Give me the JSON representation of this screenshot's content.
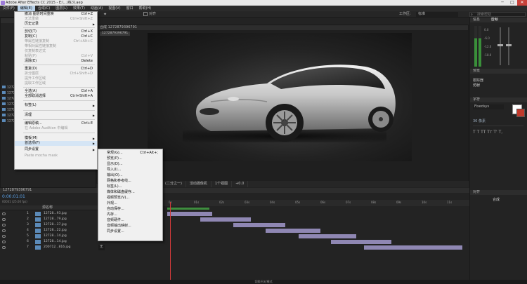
{
  "window": {
    "title": "Adobe After Effects CC 2015 - E:\\...\\练习.aep",
    "min": "─",
    "max": "□",
    "close": "✕"
  },
  "menubar": [
    "文件(F)",
    "编辑(E)",
    "合成(C)",
    "图层(L)",
    "效果(T)",
    "动画(A)",
    "视图(V)",
    "窗口",
    "帮助(H)"
  ],
  "toolbar": {
    "snap_label": "对齐",
    "workspace_label": "工作区:",
    "workspace_value": "标准",
    "search_placeholder": "搜索帮助"
  },
  "edit_menu": [
    {
      "label": "撤消 图层时间重映",
      "shortcut": "Ctrl+Z"
    },
    {
      "label": "无法重做",
      "shortcut": "Ctrl+Shift+Z",
      "disabled": true
    },
    {
      "label": "历史记录",
      "submenu": true
    },
    {
      "sep": true
    },
    {
      "label": "剪切(T)",
      "shortcut": "Ctrl+X"
    },
    {
      "label": "复制(C)",
      "shortcut": "Ctrl+C"
    },
    {
      "label": "带属性链接复制",
      "shortcut": "Ctrl+Alt+C",
      "disabled": true
    },
    {
      "label": "带相对属性链接复制",
      "disabled": true
    },
    {
      "label": "仅复制表达式",
      "disabled": true
    },
    {
      "label": "粘贴(P)",
      "shortcut": "Ctrl+V",
      "disabled": true
    },
    {
      "label": "清除(E)",
      "shortcut": "Delete"
    },
    {
      "sep": true
    },
    {
      "label": "重复(D)",
      "shortcut": "Ctrl+D"
    },
    {
      "label": "拆分图层",
      "shortcut": "Ctrl+Shift+D",
      "disabled": true
    },
    {
      "label": "提升工作区域",
      "disabled": true
    },
    {
      "label": "提取工作区域",
      "disabled": true
    },
    {
      "sep": true
    },
    {
      "label": "全选(A)",
      "shortcut": "Ctrl+A"
    },
    {
      "label": "全部取消选择",
      "shortcut": "Ctrl+Shift+A"
    },
    {
      "sep": true
    },
    {
      "label": "标签(L)",
      "submenu": true
    },
    {
      "sep": true
    },
    {
      "label": "清理",
      "submenu": true
    },
    {
      "sep": true
    },
    {
      "label": "编辑原稿...",
      "shortcut": "Ctrl+E"
    },
    {
      "label": "在 Adobe Audition 中编辑",
      "disabled": true
    },
    {
      "sep": true
    },
    {
      "label": "模板(M)",
      "submenu": true
    },
    {
      "label": "首选项(F)",
      "submenu": true,
      "highlight": true
    },
    {
      "label": "同步设置",
      "submenu": true
    },
    {
      "label": "Paste mocha mask",
      "disabled": true
    }
  ],
  "prefs_submenu": [
    {
      "label": "常规(G)...",
      "shortcut": "Ctrl+Alt+;"
    },
    {
      "label": "预览(P)..."
    },
    {
      "label": "显示(D)..."
    },
    {
      "label": "导入(I)..."
    },
    {
      "label": "输出(O)..."
    },
    {
      "label": "网格和参考线..."
    },
    {
      "label": "标签(L)..."
    },
    {
      "label": "媒体和磁盘缓存..."
    },
    {
      "label": "视频预览(V)..."
    },
    {
      "label": "外观..."
    },
    {
      "label": "自动保存..."
    },
    {
      "label": "内存..."
    },
    {
      "label": "音频硬件..."
    },
    {
      "label": "音频输出映射..."
    },
    {
      "label": "同步设置..."
    }
  ],
  "comp_panel": {
    "tab": "合成 1272879396791",
    "breadcrumb": "1272879396791"
  },
  "viewer_bar": [
    "(二分之一)",
    "活动摄像机",
    "1个视图",
    "+0.0"
  ],
  "project_panel": {
    "items": [
      "12728...jpg",
      "12728...jpg",
      "12728...jpg",
      "12728...jpg",
      "12728...jpg",
      "12728...jpg",
      "12728...jpg"
    ]
  },
  "timeline": {
    "tab": "1272879396791",
    "timecode": "0:00:01:01",
    "fps": "00031 (25.00 fps)",
    "col_header": "源名称",
    "layers": [
      {
        "num": "1",
        "name": "12728...93.jpg"
      },
      {
        "num": "2",
        "name": "12728...79.jpg"
      },
      {
        "num": "3",
        "name": "12728...37.jpg"
      },
      {
        "num": "4",
        "name": "12728...22.jpg"
      },
      {
        "num": "5",
        "name": "12728...14.jpg"
      },
      {
        "num": "6",
        "name": "12728...14.jpg"
      },
      {
        "num": "7",
        "name": "200712...816.jpg"
      }
    ],
    "mode_none": "无",
    "ruler_ticks": [
      "0s",
      "01s",
      "02s",
      "03s",
      "04s",
      "05s",
      "06s",
      "07s",
      "08s",
      "09s",
      "10s",
      "11s"
    ]
  },
  "right_panels": {
    "info_tab": "信息",
    "audio_tab": "音频",
    "db_labels": [
      "0.0",
      "-6.0",
      "-12.0",
      "-18.0",
      "-24.0"
    ],
    "preview_tab": "预览",
    "tracker_tab": "跟踪器",
    "tracker_value": "仿射",
    "char_tab": "字符",
    "font": "Fixedsys",
    "size_label": "36 像素",
    "align_tab": "对齐",
    "align_to": "合成"
  },
  "statusbar": "切换开关/模式"
}
